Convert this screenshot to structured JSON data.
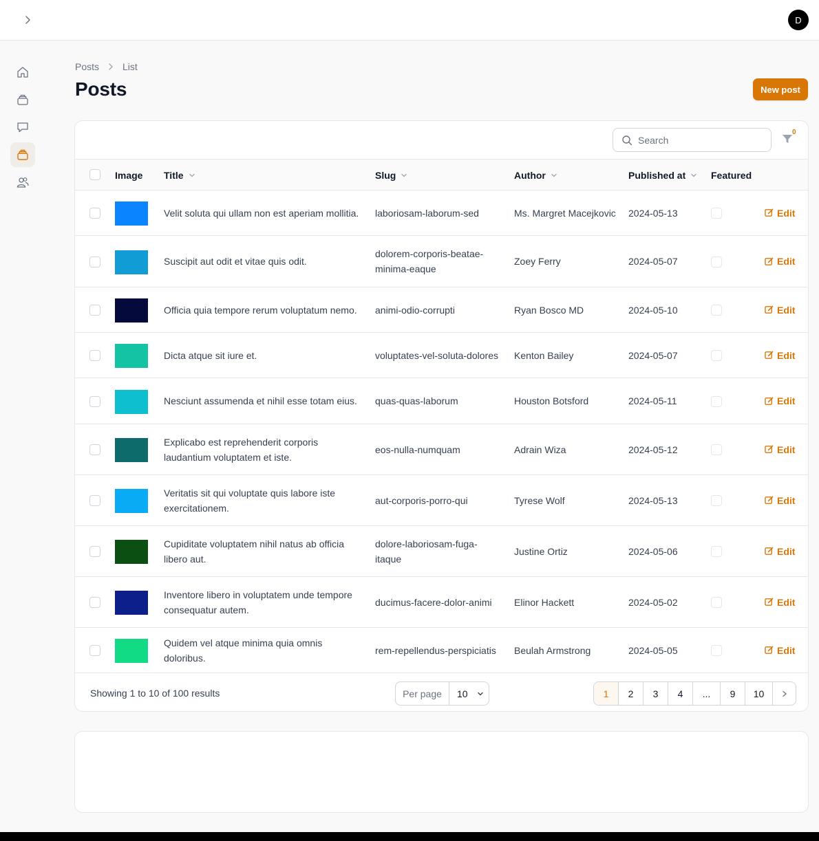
{
  "user": {
    "avatar_initial": "D"
  },
  "breadcrumb": [
    "Posts",
    "List"
  ],
  "page_title": "Posts",
  "new_post_label": "New post",
  "search": {
    "placeholder": "Search",
    "value": ""
  },
  "filter": {
    "badge": "0"
  },
  "columns": {
    "image": "Image",
    "title": "Title",
    "slug": "Slug",
    "author": "Author",
    "published_at": "Published at",
    "featured": "Featured"
  },
  "edit_label": "Edit",
  "rows": [
    {
      "title": "Velit soluta qui ullam non est aperiam mollitia.",
      "slug": "laboriosam-laborum-sed",
      "author": "Ms. Margret Macejkovic",
      "published": "2024-05-13",
      "thumb_color": "#0a84ff"
    },
    {
      "title": "Suscipit aut odit et vitae quis odit.",
      "slug": "dolorem-corporis-beatae-minima-eaque",
      "author": "Zoey Ferry",
      "published": "2024-05-07",
      "thumb_color": "#119cd6"
    },
    {
      "title": "Officia quia tempore rerum voluptatum nemo.",
      "slug": "animi-odio-corrupti",
      "author": "Ryan Bosco MD",
      "published": "2024-05-10",
      "thumb_color": "#050a3c"
    },
    {
      "title": "Dicta atque sit iure et.",
      "slug": "voluptates-vel-soluta-dolores",
      "author": "Kenton Bailey",
      "published": "2024-05-07",
      "thumb_color": "#14c3a4"
    },
    {
      "title": "Nesciunt assumenda et nihil esse totam eius.",
      "slug": "quas-quas-laborum",
      "author": "Houston Botsford",
      "published": "2024-05-11",
      "thumb_color": "#0dbfcf"
    },
    {
      "title": "Explicabo est reprehenderit corporis laudantium voluptatem et iste.",
      "slug": "eos-nulla-numquam",
      "author": "Adrain Wiza",
      "published": "2024-05-12",
      "thumb_color": "#0e6b6b"
    },
    {
      "title": "Veritatis sit qui voluptate quis labore iste exercitationem.",
      "slug": "aut-corporis-porro-qui",
      "author": "Tyrese Wolf",
      "published": "2024-05-13",
      "thumb_color": "#0aabf5"
    },
    {
      "title": "Cupiditate voluptatem nihil natus ab officia libero aut.",
      "slug": "dolore-laboriosam-fuga-itaque",
      "author": "Justine Ortiz",
      "published": "2024-05-06",
      "thumb_color": "#0b4f12"
    },
    {
      "title": "Inventore libero in voluptatem unde tempore consequatur autem.",
      "slug": "ducimus-facere-dolor-animi",
      "author": "Elinor Hackett",
      "published": "2024-05-02",
      "thumb_color": "#0c1f8a"
    },
    {
      "title": "Quidem vel atque minima quia omnis doloribus.",
      "slug": "rem-repellendus-perspiciatis",
      "author": "Beulah Armstrong",
      "published": "2024-05-05",
      "thumb_color": "#12db86"
    }
  ],
  "footer": {
    "showing": "Showing 1 to 10 of 100 results",
    "per_page_label": "Per page",
    "per_page_value": "10",
    "pages": [
      "1",
      "2",
      "3",
      "4",
      "...",
      "9",
      "10"
    ],
    "current_page": "1"
  },
  "accent_color": "#d97706"
}
